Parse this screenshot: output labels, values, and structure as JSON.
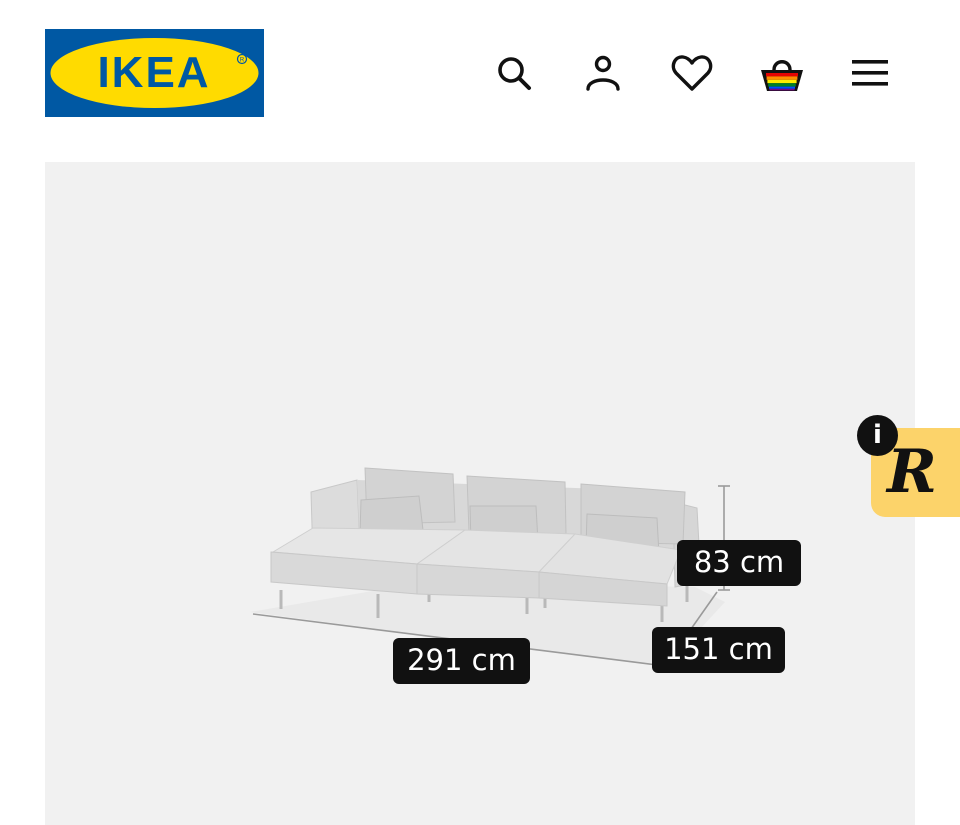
{
  "brand": {
    "logo_text": "IKEA",
    "colors": {
      "blue": "#0058a3",
      "yellow": "#ffdb00"
    }
  },
  "header": {
    "icons": [
      "search-icon",
      "account-icon",
      "favourites-icon",
      "shopping-bag-icon",
      "menu-icon"
    ]
  },
  "product_media": {
    "dimensions": {
      "width": "291 cm",
      "depth": "151 cm",
      "height": "83 cm"
    }
  },
  "widget": {
    "info_label": "i",
    "letter": "R",
    "color": "#fcd36a"
  }
}
